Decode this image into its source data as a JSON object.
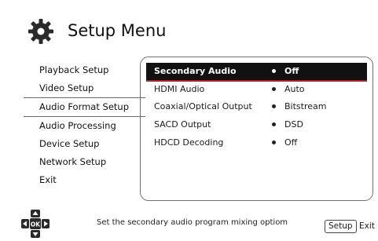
{
  "header": {
    "title": "Setup Menu",
    "icon": "gear-icon"
  },
  "sidebar": {
    "items": [
      {
        "label": "Playback Setup"
      },
      {
        "label": "Video Setup"
      },
      {
        "label": "Audio Format Setup"
      },
      {
        "label": "Audio Processing"
      },
      {
        "label": "Device Setup"
      },
      {
        "label": "Network Setup"
      },
      {
        "label": "Exit"
      }
    ],
    "active_index": 2
  },
  "settings": [
    {
      "name": "Secondary Audio",
      "value": "Off"
    },
    {
      "name": "HDMI Audio",
      "value": "Auto"
    },
    {
      "name": "Coaxial/Optical Output",
      "value": "Bitstream"
    },
    {
      "name": "SACD Output",
      "value": "DSD"
    },
    {
      "name": "HDCD Decoding",
      "value": "Off"
    }
  ],
  "selected_setting_index": 0,
  "footer": {
    "hint": "Set the secondary audio program mixing optiom",
    "setup_button": "Setup",
    "exit_label": "Exit",
    "dpad_center": "OK"
  },
  "colors": {
    "selection": "#111111",
    "selection_underline": "#9a2a22",
    "border": "#6f6f6f"
  }
}
